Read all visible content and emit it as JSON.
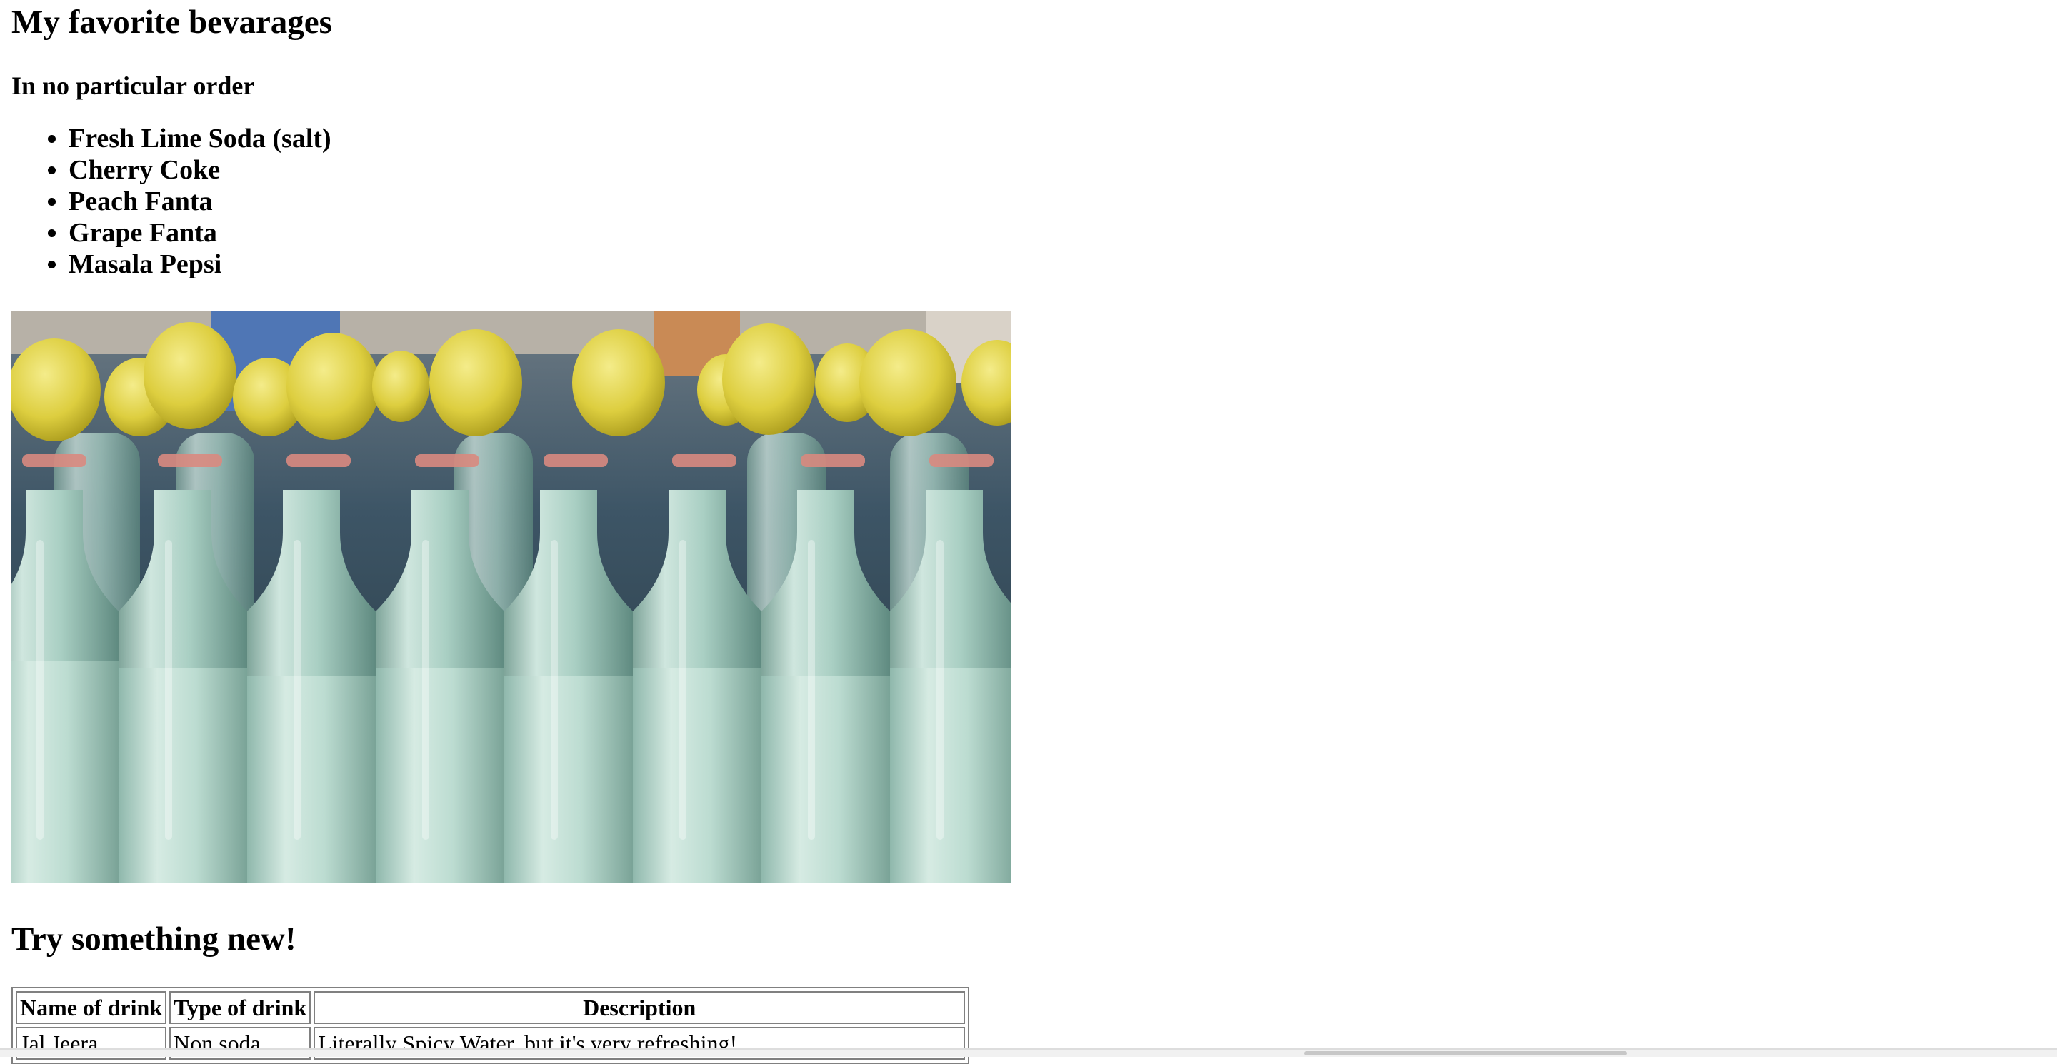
{
  "page": {
    "title": "My favorite bevarages",
    "subtitle": "In no particular order",
    "favorites": [
      "Fresh Lime Soda (salt)",
      "Cherry Coke",
      "Peach Fanta",
      "Grape Fanta",
      "Masala Pepsi"
    ],
    "image": {
      "description_icon": "photo-lemon-soda-bottles"
    },
    "section_heading": "Try something new!",
    "table": {
      "headers": [
        "Name of drink",
        "Type of drink",
        "Description"
      ],
      "rows": [
        [
          "Jal Jeera",
          "Non soda",
          "Literally Spicy Water, but it's very refreshing!"
        ]
      ]
    }
  },
  "colors": {
    "background": "#ffffff",
    "text": "#000000",
    "table_border": "#808080",
    "lemon": "#e3d34a",
    "bottle_liquid": "#b9d8cc"
  }
}
